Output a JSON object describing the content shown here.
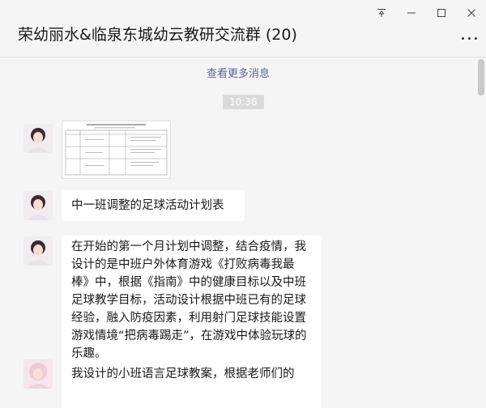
{
  "window": {
    "controls": {
      "pin": "⊤",
      "minimize": "—",
      "maximize": "☐",
      "close": "✕"
    }
  },
  "header": {
    "title": "荣幼丽水&临泉东城幼云教研交流群 (20)"
  },
  "chat": {
    "load_more": "查看更多消息",
    "time": "10:38",
    "messages": [
      {
        "type": "image",
        "content": "document-thumbnail"
      },
      {
        "type": "text",
        "text": "中一班调整的足球活动计划表"
      },
      {
        "type": "text",
        "text": "在开始的第一个月计划中调整，结合疫情，我设计的是中班户外体育游戏《打败病毒我最棒》中，根据《指南》中的健康目标以及中班足球教学目标，活动设计根据中班已有的足球经验，融入防疫因素，利用射门足球技能设置游戏情境“把病毒踢走”，在游戏中体验玩球的乐趣。"
      },
      {
        "type": "text",
        "text": "我设计的小班语言足球教案，根据老师们的"
      }
    ]
  },
  "colors": {
    "background": "#f5f5f5",
    "bubble": "#ffffff",
    "link": "#576b95",
    "time_chip": "#dadada"
  }
}
